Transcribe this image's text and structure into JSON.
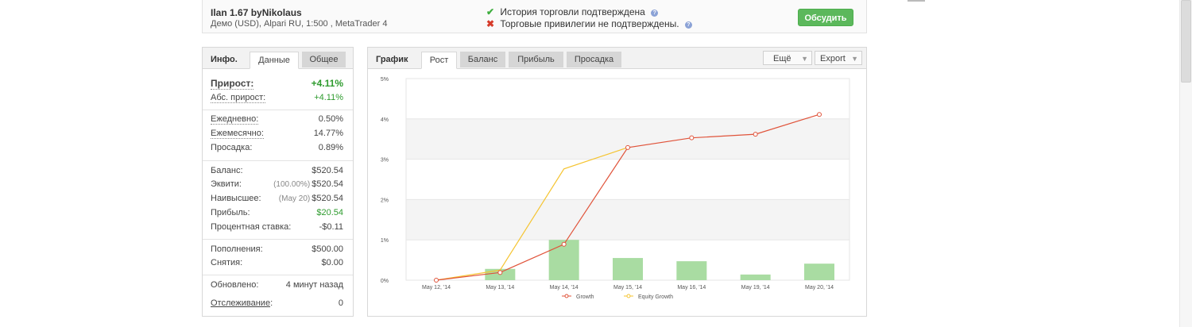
{
  "header": {
    "system_name": "Ilan 1.67 byNikolaus",
    "account_info": "Демо (USD), Alpari RU, 1:500 , MetaTrader 4",
    "history_status": "История торговли подтверждена",
    "privileges_status": "Торговые привилегии не подтверждены.",
    "help_glyph": "?",
    "check_glyph": "✔",
    "cross_glyph": "✖",
    "discuss_button": "Обсудить"
  },
  "info_panel": {
    "tabs": [
      "Инфо.",
      "Данные",
      "Общее"
    ],
    "gain_label": "Прирост:",
    "gain_value": "+4.11%",
    "abs_gain_label": "Абс. прирост:",
    "abs_gain_value": "+4.11%",
    "daily_label": "Ежедневно:",
    "daily_value": "0.50%",
    "monthly_label": "Ежемесячно:",
    "monthly_value": "14.77%",
    "drawdown_label": "Просадка:",
    "drawdown_value": "0.89%",
    "balance_label": "Баланс:",
    "balance_value": "$520.54",
    "equity_label": "Эквити:",
    "equity_note": "(100.00%)",
    "equity_value": "$520.54",
    "highest_label": "Наивысшее:",
    "highest_note": "(May 20)",
    "highest_value": "$520.54",
    "profit_label": "Прибыль:",
    "profit_value": "$20.54",
    "interest_label": "Процентная ставка:",
    "interest_value": "-$0.11",
    "deposits_label": "Пополнения:",
    "deposits_value": "$500.00",
    "withdrawals_label": "Снятия:",
    "withdrawals_value": "$0.00",
    "updated_label": "Обновлено:",
    "updated_value": "4 минут назад",
    "tracking_label": "Отслеживание",
    "tracking_colon": ":",
    "tracking_value": "0"
  },
  "chart_panel": {
    "title": "График",
    "tabs": [
      "Рост",
      "Баланс",
      "Прибыль",
      "Просадка"
    ],
    "more_button": "Ещё",
    "export_button": "Export",
    "dropdown_glyph": "▼"
  },
  "colors": {
    "growth": "#e0533a",
    "equity_growth": "#f5c431",
    "bars": "#a9dca2",
    "positive": "#2e9b2e",
    "button": "#5cb85c"
  },
  "chart_data": {
    "type": "line",
    "categories": [
      "May 12, '14",
      "May 13, '14",
      "May 14, '14",
      "May 15, '14",
      "May 16, '14",
      "May 19, '14",
      "May 20, '14"
    ],
    "series": [
      {
        "name": "Growth",
        "type": "line",
        "values": [
          0.0,
          0.19,
          0.89,
          3.29,
          3.53,
          3.62,
          4.11
        ]
      },
      {
        "name": "Equity Growth",
        "type": "line",
        "values": [
          0.0,
          0.25,
          2.76,
          3.29,
          null,
          null,
          null
        ]
      },
      {
        "type": "bar",
        "values": [
          0.0,
          0.28,
          1.0,
          0.55,
          0.47,
          0.14,
          0.41
        ]
      }
    ],
    "yticks": [
      "0%",
      "1%",
      "2%",
      "3%",
      "4%",
      "5%"
    ],
    "ylim": [
      0,
      5
    ],
    "grid": true,
    "legend": "bottom"
  }
}
